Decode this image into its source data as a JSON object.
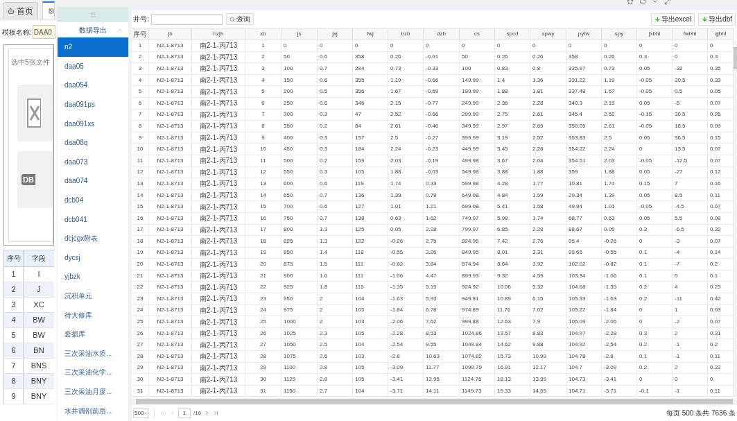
{
  "tabs": [
    {
      "label": "首页",
      "selected": false
    },
    {
      "selected": true
    }
  ],
  "left_panel": {
    "template_label": "模板名称:",
    "template_value": "DAA0",
    "hint": "选中5张文件",
    "dbf_tile_label": "DB",
    "field_table": {
      "columns": [
        "序号",
        "字段"
      ],
      "rows": [
        [
          "1",
          "I"
        ],
        [
          "2",
          "J"
        ],
        [
          "3",
          "XC"
        ],
        [
          "4",
          "BW"
        ],
        [
          "5",
          "BW"
        ],
        [
          "6",
          "BN"
        ],
        [
          "7",
          "BNS"
        ],
        [
          "8",
          "BNY"
        ],
        [
          "9",
          "BNY"
        ]
      ]
    }
  },
  "sidebar": {
    "group": {
      "label": "数据导出",
      "expanded": true
    },
    "items": [
      {
        "label": "n2",
        "selected": true
      },
      {
        "label": "daa05",
        "selected": false
      },
      {
        "label": "daa054",
        "selected": false
      },
      {
        "label": "daa091ps",
        "selected": false
      },
      {
        "label": "daa091xs",
        "selected": false
      },
      {
        "label": "daa08q",
        "selected": false
      },
      {
        "label": "daa073",
        "selected": false
      },
      {
        "label": "daa074",
        "selected": false
      },
      {
        "label": "dcb04",
        "selected": false
      },
      {
        "label": "dcb041",
        "selected": false
      },
      {
        "label": "dcjcgx附表",
        "selected": false
      },
      {
        "label": "dycsj",
        "selected": false
      },
      {
        "label": "yjbzk",
        "selected": false
      },
      {
        "label": "沉积单元",
        "selected": false
      },
      {
        "label": "待大修库",
        "selected": false
      },
      {
        "label": "套损库",
        "selected": false
      },
      {
        "label": "三次采油水质...",
        "selected": false
      },
      {
        "label": "三次采油化学...",
        "selected": false
      },
      {
        "label": "三次采油月度...",
        "selected": false
      },
      {
        "label": "水井调剖前后...",
        "selected": false
      }
    ]
  },
  "toolbar": {
    "search_label": "井号:",
    "query_button": "查询",
    "export_buttons": [
      "导出excel",
      "导出dbf"
    ]
  },
  "table": {
    "columns": [
      "序号",
      "jh",
      "hzjh",
      "xh",
      "js",
      "jxj",
      "fwj",
      "bzb",
      "dzb",
      "cs",
      "spcd",
      "spwy",
      "pyfw",
      "spy",
      "jxbhl",
      "fwbhl",
      "qjbhl"
    ],
    "rows": [
      [
        "1",
        "N2-1-8713",
        "南2-1-丙713",
        "1",
        "0",
        "0",
        "0",
        "0",
        "0",
        "0",
        "0",
        "0",
        "0",
        "0",
        "0",
        "0",
        "0"
      ],
      [
        "2",
        "N2-1-8713",
        "南2-1-丙713",
        "2",
        "50",
        "0.6",
        "358",
        "0.26",
        "-0.01",
        "50",
        "0.26",
        "0.26",
        "358",
        "0.26",
        "0.3",
        "0",
        "0.3"
      ],
      [
        "3",
        "N2-1-8713",
        "南2-1-丙713",
        "3",
        "100",
        "0.7",
        "294",
        "0.73",
        "-0.33",
        "100",
        "0.83",
        "0.8",
        "335.97",
        "0.73",
        "0.05",
        "-32",
        "0.35"
      ],
      [
        "4",
        "N2-1-8713",
        "南2-1-丙713",
        "4",
        "150",
        "0.6",
        "355",
        "1.19",
        "-0.66",
        "149.99",
        "1.4",
        "1.36",
        "331.22",
        "1.19",
        "-0.05",
        "30.5",
        "0.33"
      ],
      [
        "5",
        "N2-1-8713",
        "南2-1-丙713",
        "5",
        "200",
        "0.5",
        "356",
        "1.67",
        "-0.69",
        "199.99",
        "1.88",
        "1.81",
        "337.48",
        "1.67",
        "-0.05",
        "0.5",
        "0.05"
      ],
      [
        "6",
        "N2-1-8713",
        "南2-1-丙713",
        "6",
        "250",
        "0.6",
        "346",
        "2.15",
        "-0.77",
        "249.99",
        "2.36",
        "2.28",
        "340.3",
        "2.15",
        "0.05",
        "-5",
        "0.07"
      ],
      [
        "7",
        "N2-1-8713",
        "南2-1-丙713",
        "7",
        "300",
        "0.3",
        "47",
        "2.52",
        "-0.66",
        "299.99",
        "2.75",
        "2.61",
        "345.4",
        "2.52",
        "-0.15",
        "30.5",
        "0.26"
      ],
      [
        "8",
        "N2-1-8713",
        "南2-1-丙713",
        "8",
        "350",
        "0.2",
        "84",
        "2.61",
        "-0.46",
        "349.99",
        "2.97",
        "2.65",
        "350.05",
        "2.61",
        "-0.05",
        "18.5",
        "0.09"
      ],
      [
        "9",
        "N2-1-8713",
        "南2-1-丙713",
        "9",
        "400",
        "0.3",
        "157",
        "2.5",
        "-0.27",
        "399.99",
        "3.19",
        "2.52",
        "353.83",
        "2.5",
        "0.05",
        "36.5",
        "0.15"
      ],
      [
        "10",
        "N2-1-8713",
        "南2-1-丙713",
        "10",
        "450",
        "0.3",
        "184",
        "2.24",
        "-0.23",
        "449.99",
        "3.45",
        "2.26",
        "354.22",
        "2.24",
        "0",
        "13.5",
        "0.07"
      ],
      [
        "11",
        "N2-1-8713",
        "南2-1-丙713",
        "11",
        "500",
        "0.2",
        "159",
        "2.03",
        "-0.19",
        "499.98",
        "3.67",
        "2.04",
        "354.51",
        "2.03",
        "-0.05",
        "-12.5",
        "0.07"
      ],
      [
        "12",
        "N2-1-8713",
        "南2-1-丙713",
        "12",
        "550",
        "0.3",
        "105",
        "1.88",
        "-0.03",
        "549.98",
        "3.88",
        "1.88",
        "359",
        "1.88",
        "0.05",
        "-27",
        "0.12"
      ],
      [
        "13",
        "N2-1-8713",
        "南2-1-丙713",
        "13",
        "600",
        "0.6",
        "119",
        "1.74",
        "0.33",
        "599.98",
        "4.28",
        "1.77",
        "10.81",
        "1.74",
        "0.15",
        "7",
        "0.16"
      ],
      [
        "14",
        "N2-1-8713",
        "南2-1-丙713",
        "14",
        "650",
        "0.7",
        "136",
        "1.39",
        "0.78",
        "649.98",
        "4.84",
        "1.59",
        "29.34",
        "1.39",
        "0.05",
        "8.5",
        "0.11"
      ],
      [
        "15",
        "N2-1-8713",
        "南2-1-丙713",
        "15",
        "700",
        "0.6",
        "127",
        "1.01",
        "1.21",
        "699.98",
        "5.41",
        "1.58",
        "49.94",
        "1.01",
        "-0.05",
        "-4.5",
        "0.07"
      ],
      [
        "16",
        "N2-1-8713",
        "南2-1-丙713",
        "16",
        "750",
        "0.7",
        "138",
        "0.63",
        "1.62",
        "749.97",
        "5.98",
        "1.74",
        "68.77",
        "0.63",
        "0.05",
        "5.5",
        "0.08"
      ],
      [
        "17",
        "N2-1-8713",
        "南2-1-丙713",
        "17",
        "800",
        "1.3",
        "125",
        "0.05",
        "2.28",
        "799.97",
        "6.85",
        "2.28",
        "88.67",
        "0.05",
        "0.3",
        "-6.5",
        "0.32"
      ],
      [
        "18",
        "N2-1-8713",
        "南2-1-丙713",
        "18",
        "825",
        "1.3",
        "122",
        "-0.26",
        "2.75",
        "824.96",
        "7.42",
        "2.76",
        "95.4",
        "-0.26",
        "0",
        "-3",
        "0.07"
      ],
      [
        "19",
        "N2-1-8713",
        "南2-1-丙713",
        "19",
        "850",
        "1.4",
        "118",
        "-0.55",
        "3.26",
        "849.95",
        "8.01",
        "3.31",
        "99.65",
        "-0.55",
        "0.1",
        "-4",
        "0.14"
      ],
      [
        "20",
        "N2-1-8713",
        "南2-1-丙713",
        "20",
        "875",
        "1.5",
        "111",
        "-0.82",
        "3.84",
        "874.94",
        "8.64",
        "3.92",
        "102.02",
        "-0.82",
        "0.1",
        "-7",
        "0.2"
      ],
      [
        "21",
        "N2-1-8713",
        "南2-1-丙713",
        "21",
        "900",
        "1.6",
        "111",
        "-1.06",
        "4.47",
        "899.93",
        "9.32",
        "4.59",
        "103.34",
        "-1.06",
        "0.1",
        "0",
        "0.1"
      ],
      [
        "22",
        "N2-1-8713",
        "南2-1-丙713",
        "22",
        "925",
        "1.8",
        "115",
        "-1.35",
        "5.15",
        "924.92",
        "10.06",
        "5.32",
        "104.68",
        "-1.35",
        "0.2",
        "4",
        "0.23"
      ],
      [
        "23",
        "N2-1-8713",
        "南2-1-丙713",
        "23",
        "950",
        "2",
        "104",
        "-1.63",
        "5.93",
        "949.91",
        "10.89",
        "6.15",
        "105.33",
        "-1.63",
        "0.2",
        "-11",
        "0.42"
      ],
      [
        "24",
        "N2-1-8713",
        "南2-1-丙713",
        "24",
        "975",
        "2",
        "105",
        "-1.84",
        "6.78",
        "974.89",
        "11.76",
        "7.02",
        "105.22",
        "-1.84",
        "0",
        "1",
        "0.03"
      ],
      [
        "25",
        "N2-1-8713",
        "南2-1-丙713",
        "25",
        "1000",
        "2",
        "103",
        "-2.06",
        "7.62",
        "999.88",
        "12.63",
        "7.9",
        "105.09",
        "-2.06",
        "0",
        "-2",
        "0.07"
      ],
      [
        "26",
        "N2-1-8713",
        "南2-1-丙713",
        "26",
        "1025",
        "2.3",
        "105",
        "-2.28",
        "8.53",
        "1024.86",
        "13.57",
        "8.83",
        "104.97",
        "-2.28",
        "0.3",
        "2",
        "0.31"
      ],
      [
        "27",
        "N2-1-8713",
        "南2-1-丙713",
        "27",
        "1050",
        "2.5",
        "104",
        "-2.54",
        "9.55",
        "1049.84",
        "14.62",
        "9.88",
        "104.92",
        "-2.54",
        "0.2",
        "-1",
        "0.2"
      ],
      [
        "28",
        "N2-1-8713",
        "南2-1-丙713",
        "28",
        "1075",
        "2.6",
        "103",
        "-2.8",
        "10.63",
        "1074.82",
        "15.73",
        "10.99",
        "104.78",
        "-2.8",
        "0.1",
        "-1",
        "0.11"
      ],
      [
        "29",
        "N2-1-8713",
        "南2-1-丙713",
        "29",
        "1100",
        "2.8",
        "105",
        "-3.09",
        "11.77",
        "1099.79",
        "16.91",
        "12.17",
        "104.7",
        "-3.09",
        "0.2",
        "2",
        "0.22"
      ],
      [
        "30",
        "N2-1-8713",
        "南2-1-丙713",
        "30",
        "1125",
        "2.8",
        "105",
        "-3.41",
        "12.95",
        "1124.76",
        "18.13",
        "13.39",
        "104.73",
        "-3.41",
        "0",
        "0",
        "0"
      ],
      [
        "31",
        "N2-1-8713",
        "南2-1-丙713",
        "31",
        "1150",
        "2.7",
        "104",
        "-3.71",
        "14.11",
        "1149.73",
        "19.33",
        "14.59",
        "104.71",
        "-3.71",
        "-0.1",
        "-1",
        "0.11"
      ]
    ]
  },
  "pagination": {
    "page_size": "500",
    "page": "1",
    "total_pages": "/16",
    "summary": "每页 500 条共 7636 条"
  }
}
